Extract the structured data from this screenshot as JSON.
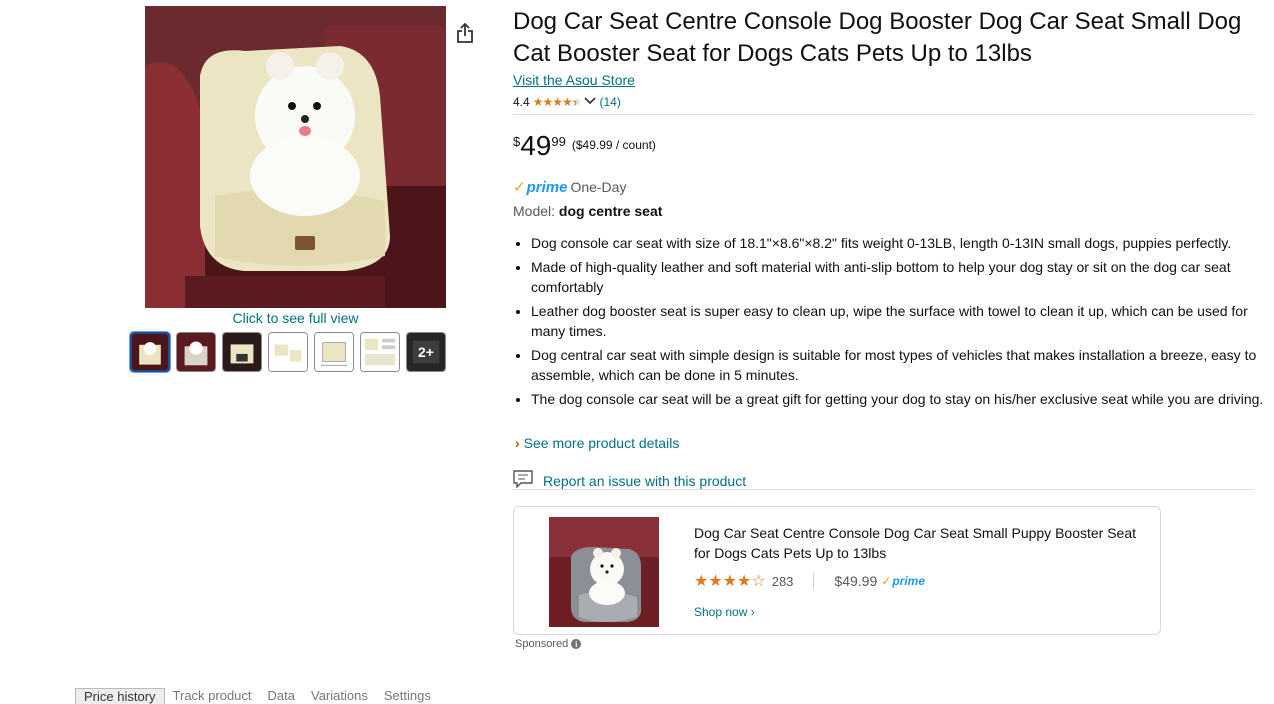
{
  "gallery": {
    "full_view_label": "Click to see full view",
    "more_count": "2+",
    "thumb_count": 7
  },
  "product": {
    "title": "Dog Car Seat Centre Console Dog Booster Dog Car Seat Small Dog Cat Booster Seat for Dogs Cats Pets Up to 13lbs",
    "store_link": "Visit the Asou Store",
    "rating": "4.4",
    "rating_value": 4.4,
    "review_count": "(14)",
    "price_symbol": "$",
    "price_whole": "49",
    "price_fraction": "99",
    "price_per_unit": "($49.99 / count)",
    "prime_label": "prime",
    "prime_delivery": "One-Day",
    "model_label": "Model:",
    "model_value": "dog centre seat",
    "bullets": [
      "Dog console car seat with size of 18.1\"×8.6\"×8.2\" fits weight 0-13LB, length 0-13IN small dogs, puppies perfectly.",
      "Made of high-quality leather and soft material with anti-slip bottom to help your dog stay or sit on the dog car seat comfortably",
      "Leather dog booster seat is super easy to clean up, wipe the surface with towel to clean it up, which can be used for many times.",
      "Dog central car seat with simple design is suitable for most types of vehicles that makes installation a breeze, easy to assemble, which can be done in 5 minutes.",
      "The dog console car seat will be a great gift for getting your dog to stay on his/her exclusive seat while you are driving."
    ],
    "see_more": "See more product details",
    "report_issue": "Report an issue with this product"
  },
  "ad": {
    "title": "Dog Car Seat Centre Console Dog Car Seat Small Puppy Booster Seat for Dogs Cats Pets Up to 13lbs",
    "rating_value": 4.0,
    "review_count": "283",
    "price": "$49.99",
    "prime_label": "prime",
    "shop_now": "Shop now ›",
    "sponsored": "Sponsored"
  },
  "bottom_tabs": [
    "Price history",
    "Track product",
    "Data",
    "Variations",
    "Settings"
  ],
  "colors": {
    "link": "#007185",
    "star": "#de7921",
    "prime_blue": "#1a98ff",
    "prime_check": "#f8a11a"
  }
}
